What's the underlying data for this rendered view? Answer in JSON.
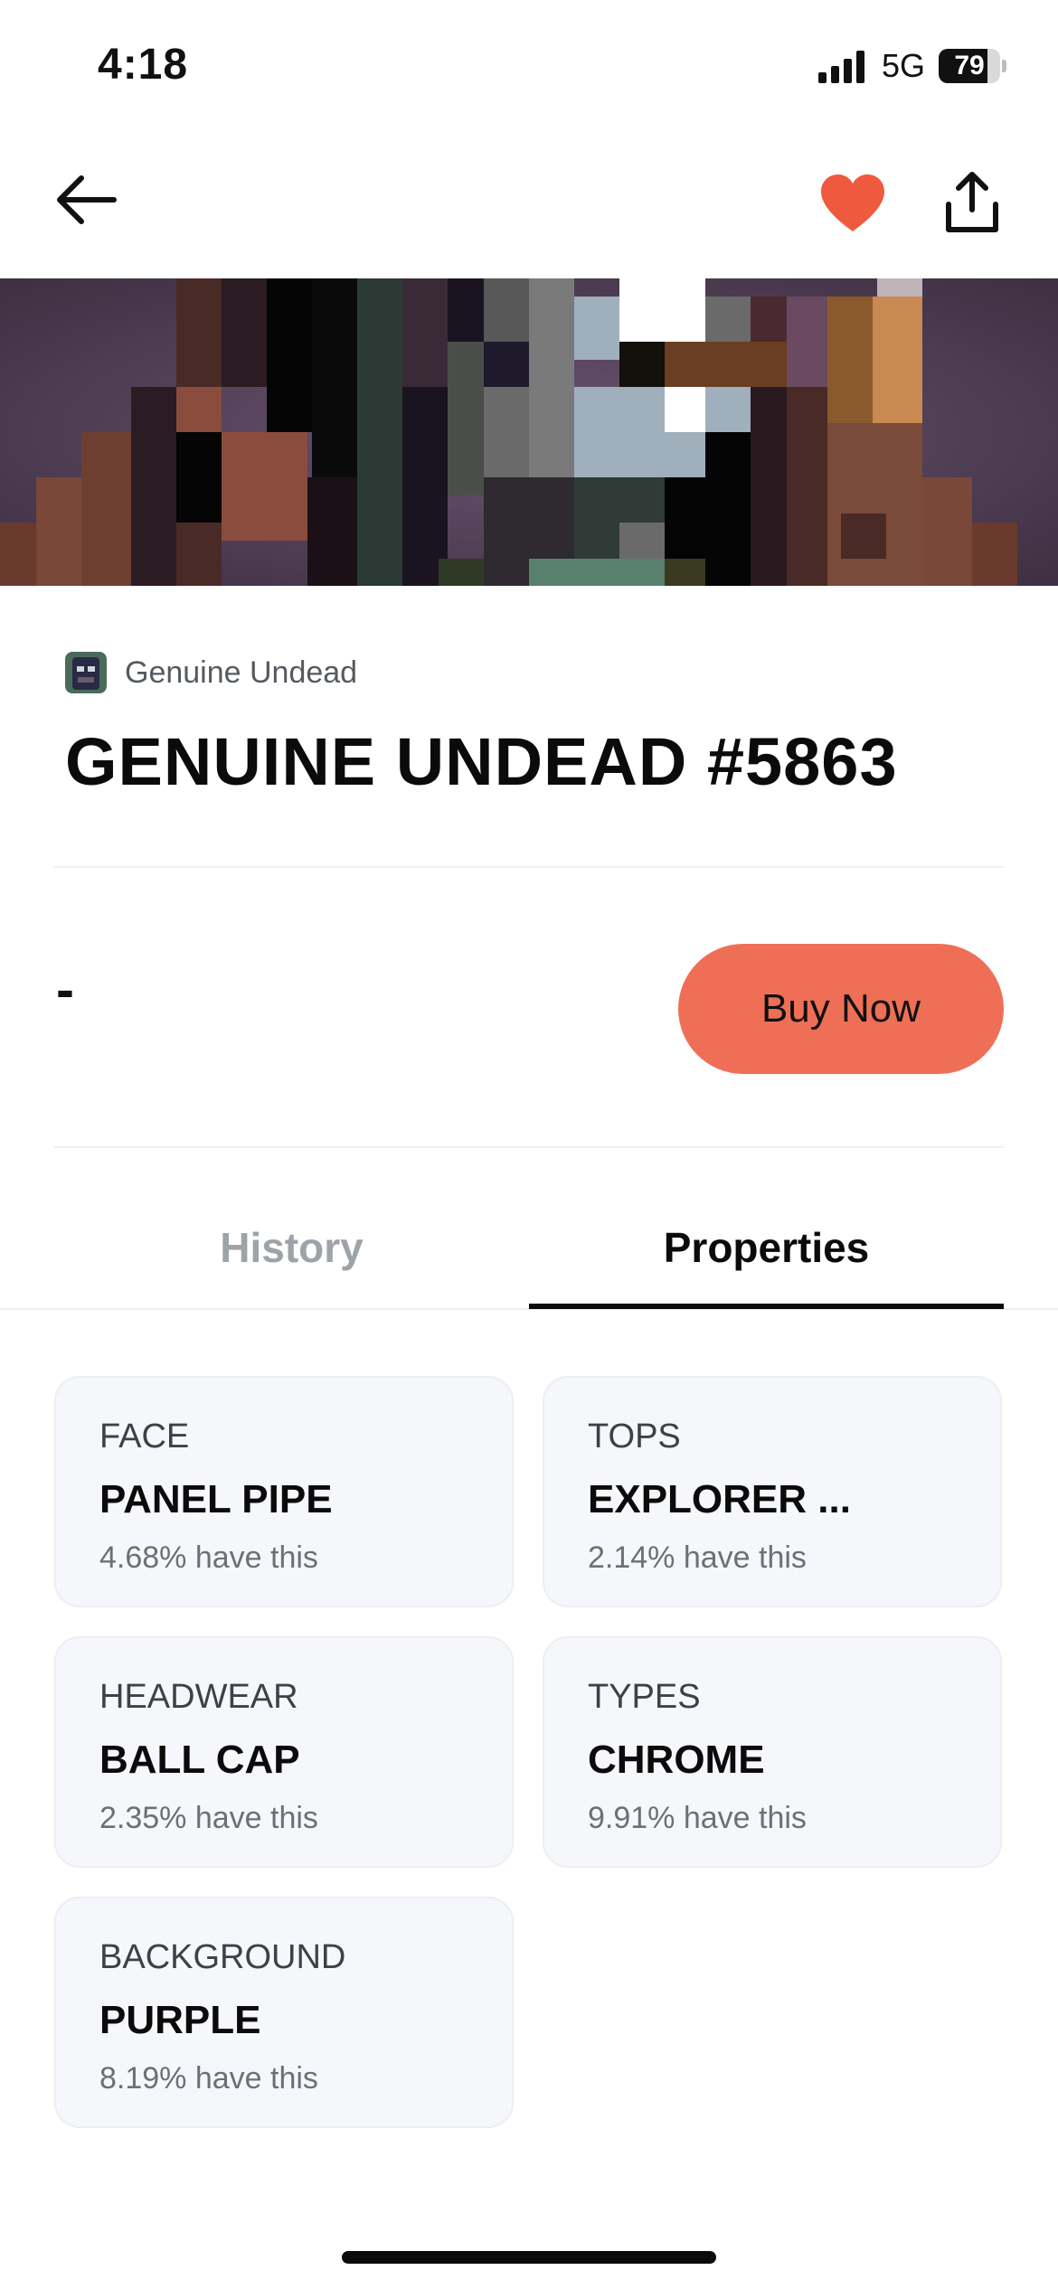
{
  "status_bar": {
    "time": "4:18",
    "network": "5G",
    "battery": "79",
    "battery_level": 0.79
  },
  "nav": {
    "back_icon": "arrow-left-icon",
    "favorite_icon": "heart-icon",
    "favorite_color": "#ef5a3e",
    "share_icon": "share-icon"
  },
  "item": {
    "collection_name": "Genuine Undead",
    "title": "GENUINE UNDEAD #5863",
    "price": "-",
    "buy_label": "Buy Now",
    "buy_color": "#ef6f56"
  },
  "tabs": [
    {
      "label": "History",
      "active": false
    },
    {
      "label": "Properties",
      "active": true
    }
  ],
  "properties": [
    {
      "type": "FACE",
      "value": "PANEL PIPE",
      "rarity": "4.68% have this"
    },
    {
      "type": "TOPS",
      "value": "EXPLORER ...",
      "rarity": "2.14% have this"
    },
    {
      "type": "HEADWEAR",
      "value": "BALL CAP",
      "rarity": "2.35% have this"
    },
    {
      "type": "TYPES",
      "value": "CHROME",
      "rarity": "9.91% have this"
    },
    {
      "type": "BACKGROUND",
      "value": "PURPLE",
      "rarity": "8.19% have this"
    }
  ]
}
